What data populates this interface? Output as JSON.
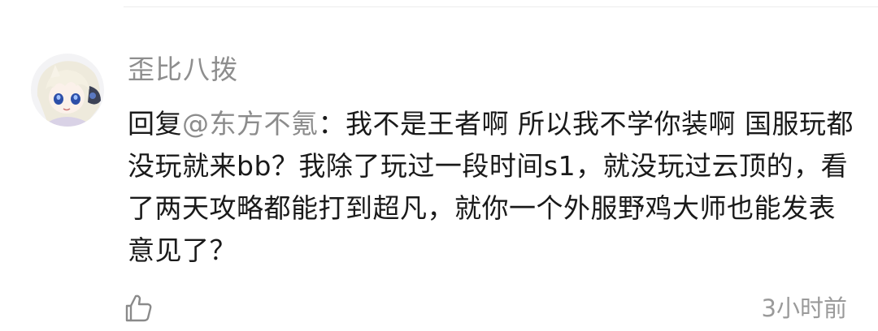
{
  "comment": {
    "author": "歪比八拨",
    "reply_prefix": "回复",
    "mention": "@东方不氪",
    "separator": "：",
    "body": "我不是王者啊 所以我不学你装啊 国服玩都没玩就来bb？我除了玩过一段时间s1，就没玩过云顶的，看了两天攻略都能打到超凡，就你一个外服野鸡大师也能发表意见了？",
    "timestamp": "3小时前"
  },
  "icons": {
    "like": "thumbs-up-icon",
    "avatar": "anime-avatar"
  },
  "colors": {
    "author": "#8e8e8e",
    "mention": "#8c8c8c",
    "body_text": "#1a1a1a",
    "timestamp": "#9a9a9a",
    "icon": "#8a8a8a"
  }
}
